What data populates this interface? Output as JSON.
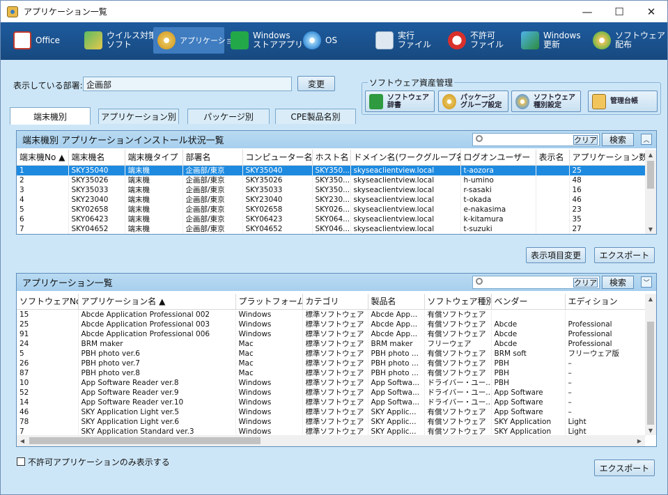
{
  "window": {
    "title": "アプリケーション一覧",
    "minimize": "—",
    "maximize": "☐",
    "close": "✕"
  },
  "toolbar": [
    {
      "label": "Office",
      "icon": "office-icon"
    },
    {
      "label": "ウイルス対策\nソフト",
      "icon": "antivirus-icon"
    },
    {
      "label": "アプリケーション",
      "icon": "application-disc-icon",
      "active": true
    },
    {
      "label": "Windows\nストアアプリ",
      "icon": "windows-store-icon"
    },
    {
      "label": "OS",
      "icon": "os-disc-icon"
    },
    {
      "label": "実行\nファイル",
      "icon": "executable-file-icon"
    },
    {
      "label": "不許可\nファイル",
      "icon": "forbidden-file-icon"
    },
    {
      "label": "Windows\n更新",
      "icon": "windows-update-icon"
    },
    {
      "label": "ソフトウェア\n配布",
      "icon": "software-distribution-icon"
    }
  ],
  "dept": {
    "label": "表示している部署:",
    "value": "企画部",
    "change_btn": "変更"
  },
  "asset": {
    "legend": "ソフトウェア資産管理",
    "buttons": [
      "ソフトウェア\n辞書",
      "パッケージ\nグループ設定",
      "ソフトウェア\n種別設定",
      "管理台帳"
    ]
  },
  "tabs": [
    "端末機別",
    "アプリケーション別",
    "パッケージ別",
    "CPE製品名別"
  ],
  "panel1": {
    "title": "端末機別 アプリケーションインストール状況一覧",
    "clear": "クリア",
    "search": "検索",
    "collapse": "︿",
    "columns": [
      "端末機No ▲",
      "端末機名",
      "端末機タイプ",
      "部署名",
      "コンピューター名",
      "ホスト名",
      "ドメイン名(ワークグループ名)",
      "ログオンユーザー",
      "表示名",
      "アプリケーション数"
    ],
    "rows": [
      [
        "1",
        "SKY35040",
        "端末機",
        "企画部/東京",
        "SKY35040",
        "SKY350...",
        "skyseaclientview.local",
        "t-aozora",
        "",
        "25"
      ],
      [
        "2",
        "SKY35026",
        "端末機",
        "企画部/東京",
        "SKY35026",
        "SKY350...",
        "skyseaclientview.local",
        "h-umino",
        "",
        "48"
      ],
      [
        "3",
        "SKY35033",
        "端末機",
        "企画部/東京",
        "SKY35033",
        "SKY350...",
        "skyseaclientview.local",
        "r-sasaki",
        "",
        "16"
      ],
      [
        "4",
        "SKY23040",
        "端末機",
        "企画部/東京",
        "SKY23040",
        "SKY230...",
        "skyseaclientview.local",
        "t-okada",
        "",
        "46"
      ],
      [
        "5",
        "SKY02658",
        "端末機",
        "企画部/東京",
        "SKY02658",
        "SKY026...",
        "skyseaclientview.local",
        "e-nakasima",
        "",
        "23"
      ],
      [
        "6",
        "SKY06423",
        "端末機",
        "企画部/東京",
        "SKY06423",
        "SKY064...",
        "skyseaclientview.local",
        "k-kitamura",
        "",
        "35"
      ],
      [
        "7",
        "SKY04652",
        "端末機",
        "企画部/東京",
        "SKY04652",
        "SKY046...",
        "skyseaclientview.local",
        "t-suzuki",
        "",
        "27"
      ]
    ]
  },
  "mid_buttons": {
    "columns": "表示項目変更",
    "export": "エクスポート"
  },
  "panel2": {
    "title": "アプリケーション一覧",
    "clear": "クリア",
    "search": "検索",
    "expand": "﹀",
    "columns": [
      "ソフトウェアNo.",
      "アプリケーション名 ▲",
      "プラットフォーム",
      "カテゴリ",
      "製品名",
      "ソフトウェア種別",
      "ベンダー",
      "エディション"
    ],
    "rows": [
      [
        "15",
        "Abcde Application Professional 002",
        "Windows",
        "標準ソフトウェア",
        "Abcde App...",
        "有償ソフトウェア",
        "",
        ""
      ],
      [
        "25",
        "Abcde Application Professional 003",
        "Windows",
        "標準ソフトウェア",
        "Abcde App...",
        "有償ソフトウェア",
        "Abcde",
        "Professional"
      ],
      [
        "91",
        "Abcde Application Professional 006",
        "Windows",
        "標準ソフトウェア",
        "Abcde App...",
        "有償ソフトウェア",
        "Abcde",
        "Professional"
      ],
      [
        "24",
        "BRM maker",
        "Mac",
        "標準ソフトウェア",
        "BRM maker",
        "フリーウェア",
        "Abcde",
        "Professional"
      ],
      [
        "5",
        "PBH photo ver.6",
        "Mac",
        "標準ソフトウェア",
        "PBH photo ...",
        "有償ソフトウェア",
        "BRM soft",
        "フリーウェア版"
      ],
      [
        "26",
        "PBH photo ver.7",
        "Mac",
        "標準ソフトウェア",
        "PBH photo ...",
        "有償ソフトウェア",
        "PBH",
        "–"
      ],
      [
        "87",
        "PBH photo ver.8",
        "Mac",
        "標準ソフトウェア",
        "PBH photo ...",
        "有償ソフトウェア",
        "PBH",
        "–"
      ],
      [
        "10",
        "App Software Reader ver.8",
        "Windows",
        "標準ソフトウェア",
        "App Softwa...",
        "ドライバー・ユー...",
        "PBH",
        "–"
      ],
      [
        "52",
        "App Software Reader ver.9",
        "Windows",
        "標準ソフトウェア",
        "App Softwa...",
        "ドライバー・ユー...",
        "App Software",
        "–"
      ],
      [
        "14",
        "App Software Reader ver.10",
        "Windows",
        "標準ソフトウェア",
        "App Softwa...",
        "ドライバー・ユー...",
        "App Software",
        "–"
      ],
      [
        "46",
        "SKY Application Light ver.5",
        "Windows",
        "標準ソフトウェア",
        "SKY Applic...",
        "有償ソフトウェア",
        "App Software",
        "–"
      ],
      [
        "78",
        "SKY Application Light ver.6",
        "Windows",
        "標準ソフトウェア",
        "SKY Applic...",
        "有償ソフトウェア",
        "SKY Application",
        "Light"
      ],
      [
        "7",
        "SKY Application Standard ver.3",
        "Windows",
        "標準ソフトウェア",
        "SKY Applic...",
        "有償ソフトウェア",
        "SKY Application",
        "Light"
      ]
    ]
  },
  "footer": {
    "checkbox_label": "不許可アプリケーションのみ表示する",
    "export": "エクスポート"
  },
  "colors": {
    "toolbar": "#1e5b9e",
    "selection": "#1d8ae0",
    "background": "#cde6f7"
  }
}
